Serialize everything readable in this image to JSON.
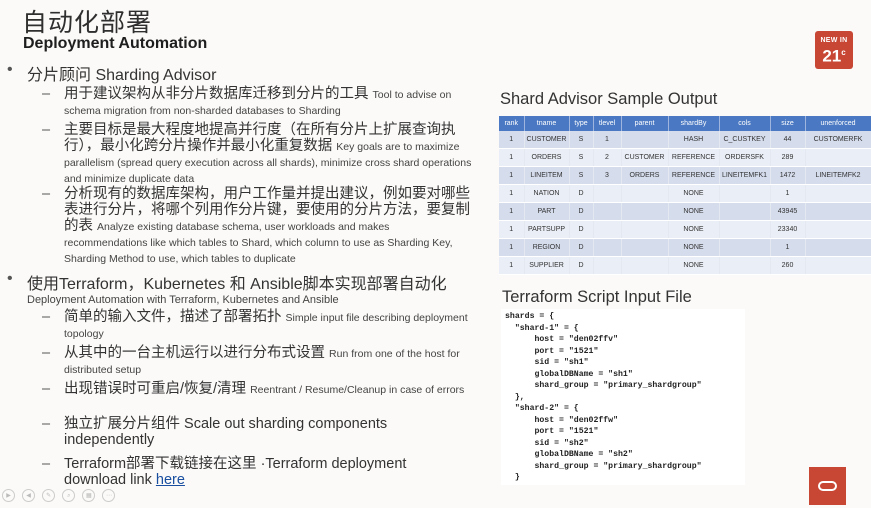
{
  "header": {
    "title_cn": "自动化部署",
    "title_en": "Deployment Automation",
    "badge_line1": "NEW IN",
    "badge_line2": "21",
    "badge_sup": "c"
  },
  "bullets": [
    {
      "text": "分片顾问 Sharding Advisor",
      "en": "",
      "subitems": [
        {
          "cn": "用于建议架构从非分片数据库迁移到分片的工具",
          "en": "Tool to advise on schema migration from non-sharded databases to Sharding"
        },
        {
          "cn": "主要目标是最大程度地提高并行度（在所有分片上扩展查询执行），最小化跨分片操作并最小化重复数据",
          "en": "Key goals are to maximize parallelism (spread query execution across all shards), minimize cross shard operations and minimize duplicate data"
        },
        {
          "cn": "分析现有的数据库架构，用户工作量并提出建议，例如要对哪些表进行分片，将哪个列用作分片键，要使用的分片方法，要复制的表",
          "en": "Analyze existing database schema, user workloads and makes recommendations like which tables to Shard, which column to use as Sharding Key, Sharding Method to use, which tables to duplicate"
        }
      ]
    },
    {
      "text": "使用Terraform，Kubernetes 和 Ansible脚本实现部署自动化",
      "en": "Deployment Automation with Terraform, Kubernetes and Ansible",
      "subitems": [
        {
          "cn": "简单的输入文件，描述了部署拓扑",
          "en": "Simple input file describing deployment topology"
        },
        {
          "cn": "从其中的一台主机运行以进行分布式设置",
          "en": "Run from one of the host for distributed setup"
        },
        {
          "cn": "出现错误时可重启/恢复/清理",
          "en": "Reentrant / Resume/Cleanup in case of errors"
        },
        {
          "cn": "独立扩展分片组件 Scale out sharding components independently",
          "en": ""
        },
        {
          "cn": "Terraform部署下载链接在这里 ·Terraform deployment download link",
          "en": "",
          "link": "here"
        }
      ]
    }
  ],
  "advisor": {
    "title": "Shard Advisor Sample Output",
    "columns": [
      "rank",
      "tname",
      "type",
      "tlevel",
      "parent",
      "shardBy",
      "cols",
      "size",
      "unenforced"
    ],
    "rows": [
      [
        "1",
        "CUSTOMER",
        "S",
        "1",
        "",
        "HASH",
        "C_CUSTKEY",
        "44",
        "CUSTOMERFK"
      ],
      [
        "1",
        "ORDERS",
        "S",
        "2",
        "CUSTOMER",
        "REFERENCE",
        "ORDERSFK",
        "289",
        ""
      ],
      [
        "1",
        "LINEITEM",
        "S",
        "3",
        "ORDERS",
        "REFERENCE",
        "LINEITEMFK1",
        "1472",
        "LINEITEMFK2"
      ],
      [
        "1",
        "NATION",
        "D",
        "",
        "",
        "NONE",
        "",
        "1",
        ""
      ],
      [
        "1",
        "PART",
        "D",
        "",
        "",
        "NONE",
        "",
        "43945",
        ""
      ],
      [
        "1",
        "PARTSUPP",
        "D",
        "",
        "",
        "NONE",
        "",
        "23340",
        ""
      ],
      [
        "1",
        "REGION",
        "D",
        "",
        "",
        "NONE",
        "",
        "1",
        ""
      ],
      [
        "1",
        "SUPPLIER",
        "D",
        "",
        "",
        "NONE",
        "",
        "260",
        ""
      ]
    ]
  },
  "terraform": {
    "title": "Terraform Script Input File",
    "code": "shards = {\n  \"shard-1\" = {\n      host = \"den02ffv\"\n      port = \"1521\"\n      sid = \"sh1\"\n      globalDBName = \"sh1\"\n      shard_group = \"primary_shardgroup\"\n  },\n  \"shard-2\" = {\n      host = \"den02ffw\"\n      port = \"1521\"\n      sid = \"sh2\"\n      globalDBName = \"sh2\"\n      shard_group = \"primary_shardgroup\"\n  }"
  },
  "colors": {
    "accent": "#c74634",
    "table_header": "#4a78c2",
    "link": "#1a4fa0"
  }
}
